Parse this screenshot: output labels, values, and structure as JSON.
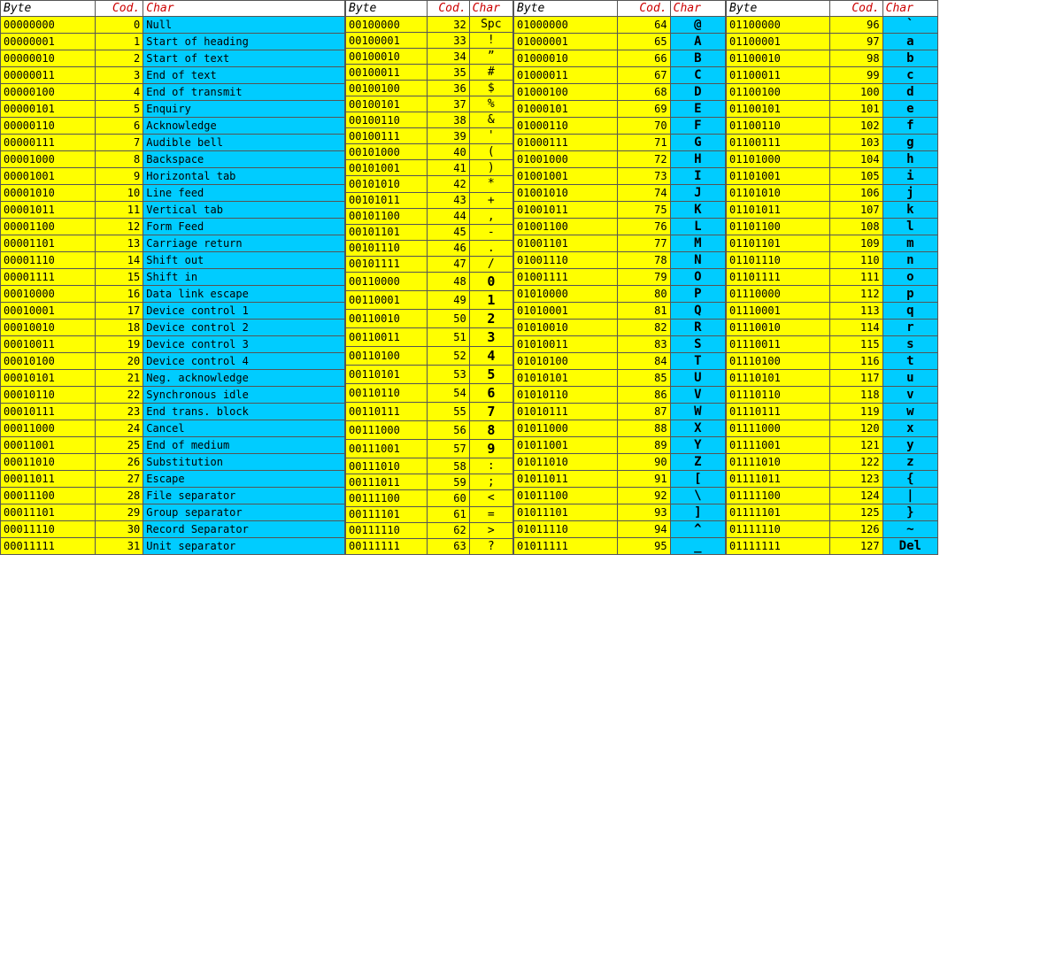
{
  "sections": [
    {
      "id": "s1",
      "headers": [
        "Byte",
        "Cod.",
        "Char"
      ],
      "rows": [
        {
          "byte": "00000000",
          "cod": "0",
          "name": "Null",
          "sym": "",
          "type": "ctrl"
        },
        {
          "byte": "00000001",
          "cod": "1",
          "name": "Start of heading",
          "sym": "",
          "type": "ctrl"
        },
        {
          "byte": "00000010",
          "cod": "2",
          "name": "Start of text",
          "sym": "",
          "type": "ctrl"
        },
        {
          "byte": "00000011",
          "cod": "3",
          "name": "End of text",
          "sym": "",
          "type": "ctrl"
        },
        {
          "byte": "00000100",
          "cod": "4",
          "name": "End of transmit",
          "sym": "",
          "type": "ctrl"
        },
        {
          "byte": "00000101",
          "cod": "5",
          "name": "Enquiry",
          "sym": "",
          "type": "ctrl"
        },
        {
          "byte": "00000110",
          "cod": "6",
          "name": "Acknowledge",
          "sym": "",
          "type": "ctrl"
        },
        {
          "byte": "00000111",
          "cod": "7",
          "name": "Audible bell",
          "sym": "",
          "type": "ctrl"
        },
        {
          "byte": "00001000",
          "cod": "8",
          "name": "Backspace",
          "sym": "",
          "type": "ctrl"
        },
        {
          "byte": "00001001",
          "cod": "9",
          "name": "Horizontal tab",
          "sym": "",
          "type": "ctrl"
        },
        {
          "byte": "00001010",
          "cod": "10",
          "name": "Line feed",
          "sym": "",
          "type": "ctrl"
        },
        {
          "byte": "00001011",
          "cod": "11",
          "name": "Vertical tab",
          "sym": "",
          "type": "ctrl"
        },
        {
          "byte": "00001100",
          "cod": "12",
          "name": "Form Feed",
          "sym": "",
          "type": "ctrl"
        },
        {
          "byte": "00001101",
          "cod": "13",
          "name": "Carriage return",
          "sym": "",
          "type": "ctrl"
        },
        {
          "byte": "00001110",
          "cod": "14",
          "name": "Shift out",
          "sym": "",
          "type": "ctrl"
        },
        {
          "byte": "00001111",
          "cod": "15",
          "name": "Shift in",
          "sym": "",
          "type": "ctrl"
        },
        {
          "byte": "00010000",
          "cod": "16",
          "name": "Data link escape",
          "sym": "",
          "type": "ctrl"
        },
        {
          "byte": "00010001",
          "cod": "17",
          "name": "Device control 1",
          "sym": "",
          "type": "ctrl"
        },
        {
          "byte": "00010010",
          "cod": "18",
          "name": "Device control 2",
          "sym": "",
          "type": "ctrl"
        },
        {
          "byte": "00010011",
          "cod": "19",
          "name": "Device control 3",
          "sym": "",
          "type": "ctrl"
        },
        {
          "byte": "00010100",
          "cod": "20",
          "name": "Device control 4",
          "sym": "",
          "type": "ctrl"
        },
        {
          "byte": "00010101",
          "cod": "21",
          "name": "Neg. acknowledge",
          "sym": "",
          "type": "ctrl"
        },
        {
          "byte": "00010110",
          "cod": "22",
          "name": "Synchronous idle",
          "sym": "",
          "type": "ctrl"
        },
        {
          "byte": "00010111",
          "cod": "23",
          "name": "End trans. block",
          "sym": "",
          "type": "ctrl"
        },
        {
          "byte": "00011000",
          "cod": "24",
          "name": "Cancel",
          "sym": "",
          "type": "ctrl"
        },
        {
          "byte": "00011001",
          "cod": "25",
          "name": "End of medium",
          "sym": "",
          "type": "ctrl"
        },
        {
          "byte": "00011010",
          "cod": "26",
          "name": "Substitution",
          "sym": "",
          "type": "ctrl"
        },
        {
          "byte": "00011011",
          "cod": "27",
          "name": "Escape",
          "sym": "",
          "type": "ctrl"
        },
        {
          "byte": "00011100",
          "cod": "28",
          "name": "File separator",
          "sym": "",
          "type": "ctrl"
        },
        {
          "byte": "00011101",
          "cod": "29",
          "name": "Group separator",
          "sym": "",
          "type": "ctrl"
        },
        {
          "byte": "00011110",
          "cod": "30",
          "name": "Record Separator",
          "sym": "",
          "type": "ctrl"
        },
        {
          "byte": "00011111",
          "cod": "31",
          "name": "Unit separator",
          "sym": "",
          "type": "ctrl"
        }
      ]
    },
    {
      "id": "s2",
      "headers": [
        "Byte",
        "Cod.",
        "Char"
      ],
      "rows": [
        {
          "byte": "00100000",
          "cod": "32",
          "sym": "Spc",
          "type": "print"
        },
        {
          "byte": "00100001",
          "cod": "33",
          "sym": "!",
          "type": "print"
        },
        {
          "byte": "00100010",
          "cod": "34",
          "sym": "”",
          "type": "print"
        },
        {
          "byte": "00100011",
          "cod": "35",
          "sym": "#",
          "type": "print"
        },
        {
          "byte": "00100100",
          "cod": "36",
          "sym": "$",
          "type": "print"
        },
        {
          "byte": "00100101",
          "cod": "37",
          "sym": "%",
          "type": "print"
        },
        {
          "byte": "00100110",
          "cod": "38",
          "sym": "&",
          "type": "print"
        },
        {
          "byte": "00100111",
          "cod": "39",
          "sym": "'",
          "type": "print"
        },
        {
          "byte": "00101000",
          "cod": "40",
          "sym": "(",
          "type": "print"
        },
        {
          "byte": "00101001",
          "cod": "41",
          "sym": ")",
          "type": "print"
        },
        {
          "byte": "00101010",
          "cod": "42",
          "sym": "*",
          "type": "print"
        },
        {
          "byte": "00101011",
          "cod": "43",
          "sym": "+",
          "type": "print"
        },
        {
          "byte": "00101100",
          "cod": "44",
          "sym": ",",
          "type": "print"
        },
        {
          "byte": "00101101",
          "cod": "45",
          "sym": "-",
          "type": "print"
        },
        {
          "byte": "00101110",
          "cod": "46",
          "sym": ".",
          "type": "print"
        },
        {
          "byte": "00101111",
          "cod": "47",
          "sym": "/",
          "type": "print"
        },
        {
          "byte": "00110000",
          "cod": "48",
          "sym": "0",
          "type": "print"
        },
        {
          "byte": "00110001",
          "cod": "49",
          "sym": "1",
          "type": "print"
        },
        {
          "byte": "00110010",
          "cod": "50",
          "sym": "2",
          "type": "print"
        },
        {
          "byte": "00110011",
          "cod": "51",
          "sym": "3",
          "type": "print"
        },
        {
          "byte": "00110100",
          "cod": "52",
          "sym": "4",
          "type": "print"
        },
        {
          "byte": "00110101",
          "cod": "53",
          "sym": "5",
          "type": "print"
        },
        {
          "byte": "00110110",
          "cod": "54",
          "sym": "6",
          "type": "print"
        },
        {
          "byte": "00110111",
          "cod": "55",
          "sym": "7",
          "type": "print"
        },
        {
          "byte": "00111000",
          "cod": "56",
          "sym": "8",
          "type": "print"
        },
        {
          "byte": "00111001",
          "cod": "57",
          "sym": "9",
          "type": "print"
        },
        {
          "byte": "00111010",
          "cod": "58",
          "sym": ":",
          "type": "print"
        },
        {
          "byte": "00111011",
          "cod": "59",
          "sym": ";",
          "type": "print"
        },
        {
          "byte": "00111100",
          "cod": "60",
          "sym": "<",
          "type": "print"
        },
        {
          "byte": "00111101",
          "cod": "61",
          "sym": "=",
          "type": "print"
        },
        {
          "byte": "00111110",
          "cod": "62",
          "sym": ">",
          "type": "print"
        },
        {
          "byte": "00111111",
          "cod": "63",
          "sym": "?",
          "type": "print"
        }
      ]
    },
    {
      "id": "s3",
      "headers": [
        "Byte",
        "Cod.",
        "Char"
      ],
      "rows": [
        {
          "byte": "01000000",
          "cod": "64",
          "sym": "@",
          "type": "print"
        },
        {
          "byte": "01000001",
          "cod": "65",
          "sym": "A",
          "type": "print"
        },
        {
          "byte": "01000010",
          "cod": "66",
          "sym": "B",
          "type": "print"
        },
        {
          "byte": "01000011",
          "cod": "67",
          "sym": "C",
          "type": "print"
        },
        {
          "byte": "01000100",
          "cod": "68",
          "sym": "D",
          "type": "print"
        },
        {
          "byte": "01000101",
          "cod": "69",
          "sym": "E",
          "type": "print"
        },
        {
          "byte": "01000110",
          "cod": "70",
          "sym": "F",
          "type": "print"
        },
        {
          "byte": "01000111",
          "cod": "71",
          "sym": "G",
          "type": "print"
        },
        {
          "byte": "01001000",
          "cod": "72",
          "sym": "H",
          "type": "print"
        },
        {
          "byte": "01001001",
          "cod": "73",
          "sym": "I",
          "type": "print"
        },
        {
          "byte": "01001010",
          "cod": "74",
          "sym": "J",
          "type": "print"
        },
        {
          "byte": "01001011",
          "cod": "75",
          "sym": "K",
          "type": "print"
        },
        {
          "byte": "01001100",
          "cod": "76",
          "sym": "L",
          "type": "print"
        },
        {
          "byte": "01001101",
          "cod": "77",
          "sym": "M",
          "type": "print"
        },
        {
          "byte": "01001110",
          "cod": "78",
          "sym": "N",
          "type": "print"
        },
        {
          "byte": "01001111",
          "cod": "79",
          "sym": "O",
          "type": "print"
        },
        {
          "byte": "01010000",
          "cod": "80",
          "sym": "P",
          "type": "print"
        },
        {
          "byte": "01010001",
          "cod": "81",
          "sym": "Q",
          "type": "print"
        },
        {
          "byte": "01010010",
          "cod": "82",
          "sym": "R",
          "type": "print"
        },
        {
          "byte": "01010011",
          "cod": "83",
          "sym": "S",
          "type": "print"
        },
        {
          "byte": "01010100",
          "cod": "84",
          "sym": "T",
          "type": "print"
        },
        {
          "byte": "01010101",
          "cod": "85",
          "sym": "U",
          "type": "print"
        },
        {
          "byte": "01010110",
          "cod": "86",
          "sym": "V",
          "type": "print"
        },
        {
          "byte": "01010111",
          "cod": "87",
          "sym": "W",
          "type": "print"
        },
        {
          "byte": "01011000",
          "cod": "88",
          "sym": "X",
          "type": "print"
        },
        {
          "byte": "01011001",
          "cod": "89",
          "sym": "Y",
          "type": "print"
        },
        {
          "byte": "01011010",
          "cod": "90",
          "sym": "Z",
          "type": "print"
        },
        {
          "byte": "01011011",
          "cod": "91",
          "sym": "[",
          "type": "print"
        },
        {
          "byte": "01011100",
          "cod": "92",
          "sym": "\\",
          "type": "print"
        },
        {
          "byte": "01011101",
          "cod": "93",
          "sym": "]",
          "type": "print"
        },
        {
          "byte": "01011110",
          "cod": "94",
          "sym": "^",
          "type": "print"
        },
        {
          "byte": "01011111",
          "cod": "95",
          "sym": "_",
          "type": "print"
        }
      ]
    },
    {
      "id": "s4",
      "headers": [
        "Byte",
        "Cod.",
        "Char"
      ],
      "rows": [
        {
          "byte": "01100000",
          "cod": "96",
          "sym": "`",
          "type": "print"
        },
        {
          "byte": "01100001",
          "cod": "97",
          "sym": "a",
          "type": "print"
        },
        {
          "byte": "01100010",
          "cod": "98",
          "sym": "b",
          "type": "print"
        },
        {
          "byte": "01100011",
          "cod": "99",
          "sym": "c",
          "type": "print"
        },
        {
          "byte": "01100100",
          "cod": "100",
          "sym": "d",
          "type": "print"
        },
        {
          "byte": "01100101",
          "cod": "101",
          "sym": "e",
          "type": "print"
        },
        {
          "byte": "01100110",
          "cod": "102",
          "sym": "f",
          "type": "print"
        },
        {
          "byte": "01100111",
          "cod": "103",
          "sym": "g",
          "type": "print"
        },
        {
          "byte": "01101000",
          "cod": "104",
          "sym": "h",
          "type": "print"
        },
        {
          "byte": "01101001",
          "cod": "105",
          "sym": "i",
          "type": "print"
        },
        {
          "byte": "01101010",
          "cod": "106",
          "sym": "j",
          "type": "print"
        },
        {
          "byte": "01101011",
          "cod": "107",
          "sym": "k",
          "type": "print"
        },
        {
          "byte": "01101100",
          "cod": "108",
          "sym": "l",
          "type": "print"
        },
        {
          "byte": "01101101",
          "cod": "109",
          "sym": "m",
          "type": "print"
        },
        {
          "byte": "01101110",
          "cod": "110",
          "sym": "n",
          "type": "print"
        },
        {
          "byte": "01101111",
          "cod": "111",
          "sym": "o",
          "type": "print"
        },
        {
          "byte": "01110000",
          "cod": "112",
          "sym": "p",
          "type": "print"
        },
        {
          "byte": "01110001",
          "cod": "113",
          "sym": "q",
          "type": "print"
        },
        {
          "byte": "01110010",
          "cod": "114",
          "sym": "r",
          "type": "print"
        },
        {
          "byte": "01110011",
          "cod": "115",
          "sym": "s",
          "type": "print"
        },
        {
          "byte": "01110100",
          "cod": "116",
          "sym": "t",
          "type": "print"
        },
        {
          "byte": "01110101",
          "cod": "117",
          "sym": "u",
          "type": "print"
        },
        {
          "byte": "01110110",
          "cod": "118",
          "sym": "v",
          "type": "print"
        },
        {
          "byte": "01110111",
          "cod": "119",
          "sym": "w",
          "type": "print"
        },
        {
          "byte": "01111000",
          "cod": "120",
          "sym": "x",
          "type": "print"
        },
        {
          "byte": "01111001",
          "cod": "121",
          "sym": "y",
          "type": "print"
        },
        {
          "byte": "01111010",
          "cod": "122",
          "sym": "z",
          "type": "print"
        },
        {
          "byte": "01111011",
          "cod": "123",
          "sym": "{",
          "type": "print"
        },
        {
          "byte": "01111100",
          "cod": "124",
          "sym": "|",
          "type": "print"
        },
        {
          "byte": "01111101",
          "cod": "125",
          "sym": "}",
          "type": "print"
        },
        {
          "byte": "01111110",
          "cod": "126",
          "sym": "~",
          "type": "print"
        },
        {
          "byte": "01111111",
          "cod": "127",
          "sym": "Del",
          "type": "print"
        }
      ]
    }
  ]
}
